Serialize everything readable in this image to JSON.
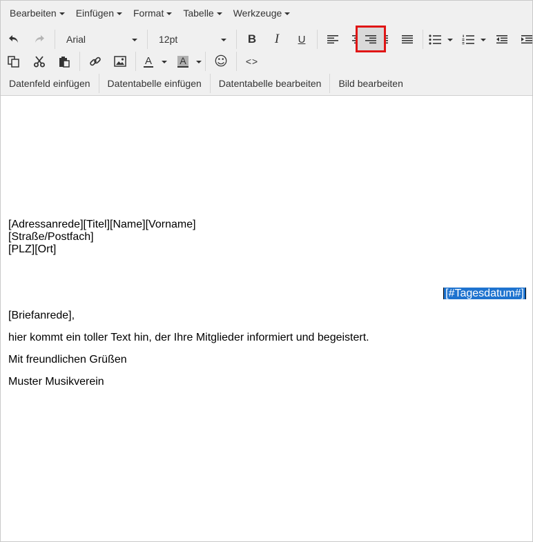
{
  "menubar": {
    "items": [
      {
        "label": "Bearbeiten"
      },
      {
        "label": "Einfügen"
      },
      {
        "label": "Format"
      },
      {
        "label": "Tabelle"
      },
      {
        "label": "Werkzeuge"
      }
    ]
  },
  "toolbar": {
    "font_family": "Arial",
    "font_size": "12pt",
    "bold_glyph": "B",
    "italic_glyph": "I",
    "underline_glyph": "U",
    "text_color_glyph": "A",
    "bg_color_glyph": "A",
    "emoji_glyph": "☺",
    "code_glyph": "<>",
    "active_button": "align-right",
    "highlight_color": "#e01515"
  },
  "actions": {
    "items": [
      {
        "label": "Datenfeld einfügen"
      },
      {
        "label": "Datentabelle einfügen"
      },
      {
        "label": "Datentabelle bearbeiten"
      },
      {
        "label": "Bild bearbeiten"
      }
    ]
  },
  "document": {
    "address_lines": [
      "[Adressanrede][Titel][Name][Vorname]",
      "[Straße/Postfach]",
      "[PLZ][Ort]"
    ],
    "date_field": "[#Tagesdatum#]",
    "salutation": "[Briefanrede],",
    "body": "hier kommt ein toller Text hin, der Ihre Mitglieder informiert und begeistert.",
    "closing": "Mit freundlichen Grüßen",
    "signature": "Muster Musikverein"
  },
  "colors": {
    "selection": "#1e73cf",
    "toolbar_bg": "#f0f0f0"
  }
}
